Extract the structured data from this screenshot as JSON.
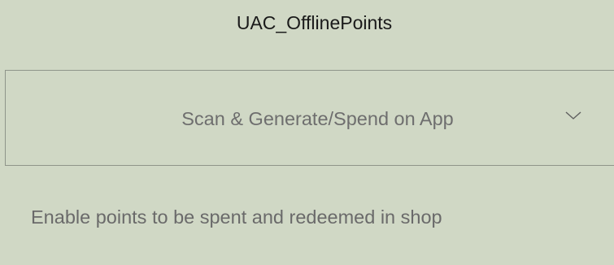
{
  "setting": {
    "title": "UAC_OfflinePoints",
    "select": {
      "selected_value": "Scan & Generate/Spend on App",
      "icon": "chevron-down-icon"
    },
    "description": "Enable points to be spent and redeemed in shop"
  },
  "colors": {
    "background": "#d0d8c5",
    "border": "#8f958a",
    "title_text": "#1a1a1a",
    "muted_text": "#6e6e6e"
  }
}
